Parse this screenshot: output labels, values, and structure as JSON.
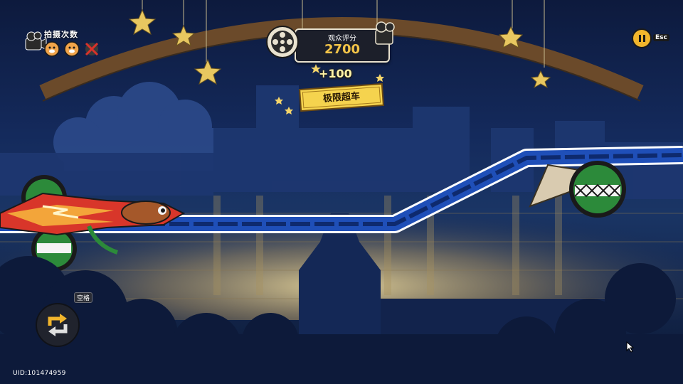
{
  "hud": {
    "shots_label": "拍摄次数",
    "score_label": "观众评分",
    "score_value": "2700",
    "bonus_text": "+100",
    "banner_text": "极限超车",
    "esc_label": "Esc",
    "key_hint": "空格",
    "uid": "UID:101474959"
  },
  "icons": {
    "camera": "camera-icon",
    "shot_tokens": [
      "hamster-token-icon",
      "hamster-token-icon",
      "crossed-out-token-icon"
    ],
    "film_reel": "film-reel-icon",
    "pause": "pause-icon",
    "swap": "swap-arrows-icon"
  },
  "colors": {
    "score": "#f3c448",
    "banner": "#f5d34e",
    "pause_button": "#f1b52c",
    "track_blue": "#1f4fb8",
    "car_red": "#d8362a"
  }
}
